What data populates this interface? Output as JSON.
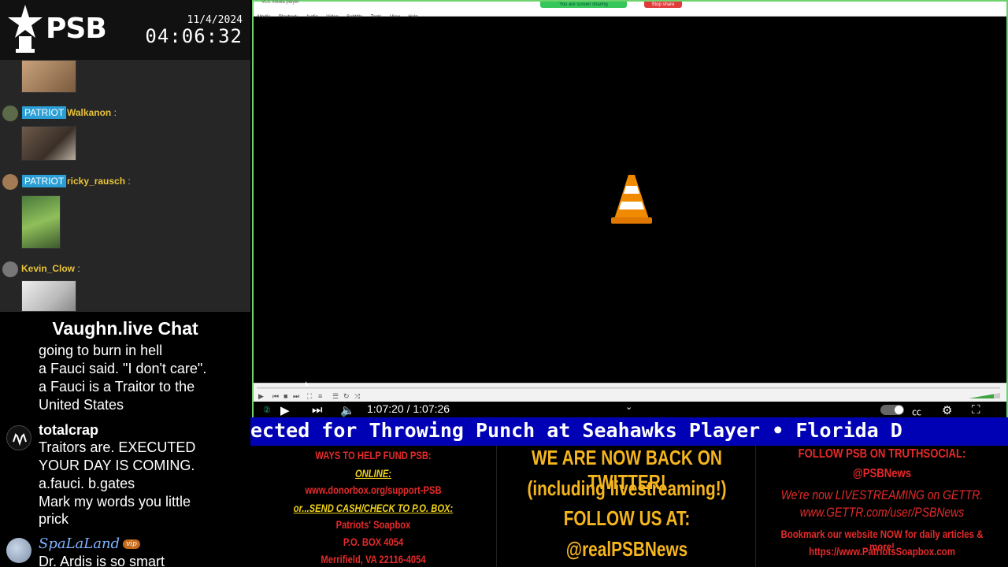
{
  "brand": {
    "logo_text": "PSB",
    "date": "11/4/2024",
    "time": "04:06:32"
  },
  "upper_chat": [
    {
      "badge": "",
      "user": "",
      "has_image": true
    },
    {
      "badge": "PATRIOT",
      "user": "Walkanon",
      "suffix": ":"
    },
    {
      "badge": "PATRIOT",
      "user": "ricky_rausch",
      "suffix": ":"
    },
    {
      "badge": "",
      "user": "Kevin_Clow",
      "suffix": ":"
    }
  ],
  "lower_chat": {
    "title": "Vaughn.live Chat",
    "lines": [
      "going to burn in hell",
      "a Fauci said. \"I don't care\".",
      "a Fauci is a Traitor to the",
      "United States"
    ],
    "messages": [
      {
        "user": "totalcrap",
        "lines": [
          "Traitors are. EXECUTED",
          "YOUR DAY IS COMING.",
          "a.fauci. b.gates",
          "Mark my words you little",
          "prick"
        ]
      },
      {
        "user": "SpaLaLand",
        "badge": "vip",
        "lines": [
          "Dr. Ardis is so smart"
        ]
      }
    ]
  },
  "vlc": {
    "window_title": "VLC media player",
    "screen_share_label": "You are screen sharing",
    "stop_share_label": "Stop share",
    "menu": [
      "Media",
      "Playback",
      "Audio",
      "Video",
      "Subtitle",
      "Tools",
      "View",
      "Help"
    ],
    "volume_label": "100%"
  },
  "player": {
    "time": "1:07:20 / 1:07:26"
  },
  "ticker": {
    "text": "ected for Throwing Punch at Seahawks Player  •  Florida D"
  },
  "panels": {
    "fund": {
      "heading": "WAYS TO HELP FUND PSB:",
      "online_label": "ONLINE:",
      "online_url": "www.donorbox.org/support-PSB",
      "mail_label": "or...SEND CASH/CHECK TO P.O. BOX:",
      "addr1": "Patriots' Soapbox",
      "addr2": "P.O. BOX 4054",
      "addr3": "Merrifield, VA 22116-4054"
    },
    "twitter": {
      "line1": "WE ARE NOW BACK ON TWITTER!",
      "line2": "(including livestreaming!)",
      "line3": "FOLLOW US AT:",
      "line4": "@realPSBNews"
    },
    "truth": {
      "heading": "FOLLOW PSB ON TRUTHSOCIAL:",
      "handle": "@PSBNews",
      "gettr1": "We're now LIVESTREAMING on GETTR.",
      "gettr2": "www.GETTR.com/user/PSBNews",
      "site1": "Bookmark our website NOW for daily articles & more!",
      "site2": "https://www.PatriotsSoapbox.com"
    }
  },
  "colors": {
    "badge_blue": "#2b9fd5",
    "username_gold": "#e8c33a",
    "ticker_blue": "#0000b4",
    "panel_red": "#e52a2a",
    "panel_gold": "#f5b51e",
    "vlc_orange": "#f08a00"
  }
}
